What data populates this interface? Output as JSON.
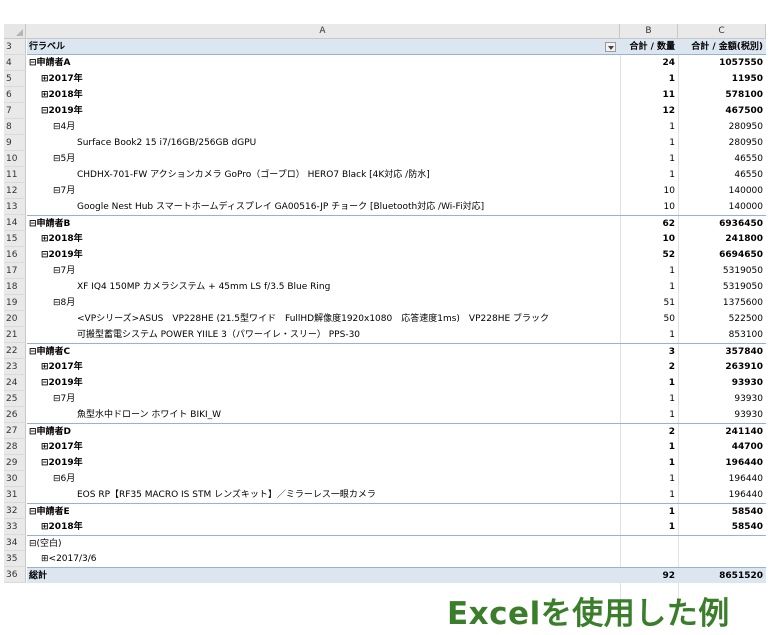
{
  "columns": {
    "a": "A",
    "b": "B",
    "c": "C"
  },
  "header": {
    "num": "3",
    "label": "行ラベル",
    "b": "合計 / 数量",
    "c": "合計 / 金額(税別)"
  },
  "rows": [
    {
      "num": "4",
      "label": "⊟申請者A",
      "b": "24",
      "c": "1057550",
      "lvl": 0,
      "bold": true
    },
    {
      "num": "5",
      "label": "⊞2017年",
      "b": "1",
      "c": "11950",
      "lvl": 1,
      "bold": true
    },
    {
      "num": "6",
      "label": "⊞2018年",
      "b": "11",
      "c": "578100",
      "lvl": 1,
      "bold": true
    },
    {
      "num": "7",
      "label": "⊟2019年",
      "b": "12",
      "c": "467500",
      "lvl": 1,
      "bold": true
    },
    {
      "num": "8",
      "label": "⊟4月",
      "b": "1",
      "c": "280950",
      "lvl": 2,
      "bold": false
    },
    {
      "num": "9",
      "label": "Surface Book2 15 i7/16GB/256GB dGPU",
      "b": "1",
      "c": "280950",
      "lvl": 3,
      "bold": false
    },
    {
      "num": "10",
      "label": "⊟5月",
      "b": "1",
      "c": "46550",
      "lvl": 2,
      "bold": false
    },
    {
      "num": "11",
      "label": "CHDHX-701-FW アクションカメラ GoPro（ゴープロ） HERO7 Black [4K対応 /防水]",
      "b": "1",
      "c": "46550",
      "lvl": 3,
      "bold": false
    },
    {
      "num": "12",
      "label": "⊟7月",
      "b": "10",
      "c": "140000",
      "lvl": 2,
      "bold": false
    },
    {
      "num": "13",
      "label": "Google Nest Hub スマートホームディスプレイ GA00516-JP チョーク [Bluetooth対応 /Wi-Fi対応]",
      "b": "10",
      "c": "140000",
      "lvl": 3,
      "bold": false
    },
    {
      "num": "14",
      "label": "⊟申請者B",
      "b": "62",
      "c": "6936450",
      "lvl": 0,
      "bold": true,
      "topline": true
    },
    {
      "num": "15",
      "label": "⊞2018年",
      "b": "10",
      "c": "241800",
      "lvl": 1,
      "bold": true
    },
    {
      "num": "16",
      "label": "⊟2019年",
      "b": "52",
      "c": "6694650",
      "lvl": 1,
      "bold": true
    },
    {
      "num": "17",
      "label": "⊟7月",
      "b": "1",
      "c": "5319050",
      "lvl": 2,
      "bold": false
    },
    {
      "num": "18",
      "label": "XF IQ4 150MP カメラシステム + 45mm LS f/3.5 Blue Ring",
      "b": "1",
      "c": "5319050",
      "lvl": 3,
      "bold": false
    },
    {
      "num": "19",
      "label": "⊟8月",
      "b": "51",
      "c": "1375600",
      "lvl": 2,
      "bold": false
    },
    {
      "num": "20",
      "label": "<VPシリーズ>ASUS　VP228HE (21.5型ワイド　FullHD解像度1920x1080　応答速度1ms)　VP228HE ブラック",
      "b": "50",
      "c": "522500",
      "lvl": 3,
      "bold": false
    },
    {
      "num": "21",
      "label": "可搬型蓄電システム POWER YIILE 3（パワーイレ・スリー） PPS-30",
      "b": "1",
      "c": "853100",
      "lvl": 3,
      "bold": false
    },
    {
      "num": "22",
      "label": "⊟申請者C",
      "b": "3",
      "c": "357840",
      "lvl": 0,
      "bold": true,
      "topline": true
    },
    {
      "num": "23",
      "label": "⊞2017年",
      "b": "2",
      "c": "263910",
      "lvl": 1,
      "bold": true
    },
    {
      "num": "24",
      "label": "⊟2019年",
      "b": "1",
      "c": "93930",
      "lvl": 1,
      "bold": true
    },
    {
      "num": "25",
      "label": "⊟7月",
      "b": "1",
      "c": "93930",
      "lvl": 2,
      "bold": false
    },
    {
      "num": "26",
      "label": "魚型水中ドローン ホワイト BIKI_W",
      "b": "1",
      "c": "93930",
      "lvl": 3,
      "bold": false
    },
    {
      "num": "27",
      "label": "⊟申請者D",
      "b": "2",
      "c": "241140",
      "lvl": 0,
      "bold": true,
      "topline": true
    },
    {
      "num": "28",
      "label": "⊞2017年",
      "b": "1",
      "c": "44700",
      "lvl": 1,
      "bold": true
    },
    {
      "num": "29",
      "label": "⊟2019年",
      "b": "1",
      "c": "196440",
      "lvl": 1,
      "bold": true
    },
    {
      "num": "30",
      "label": "⊟6月",
      "b": "1",
      "c": "196440",
      "lvl": 2,
      "bold": false
    },
    {
      "num": "31",
      "label": "EOS RP【RF35 MACRO IS STM レンズキット】／ミラーレス一眼カメラ",
      "b": "1",
      "c": "196440",
      "lvl": 3,
      "bold": false
    },
    {
      "num": "32",
      "label": "⊟申請者E",
      "b": "1",
      "c": "58540",
      "lvl": 0,
      "bold": true,
      "topline": true
    },
    {
      "num": "33",
      "label": "⊞2018年",
      "b": "1",
      "c": "58540",
      "lvl": 1,
      "bold": true
    },
    {
      "num": "34",
      "label": "⊟(空白)",
      "b": "",
      "c": "",
      "lvl": 0,
      "bold": false,
      "topline": true
    },
    {
      "num": "35",
      "label": "⊞<2017/3/6",
      "b": "",
      "c": "",
      "lvl": 1,
      "bold": false
    },
    {
      "num": "36",
      "label": "総計",
      "b": "92",
      "c": "8651520",
      "lvl": 0,
      "bold": true,
      "total": true
    }
  ],
  "caption": "Excelを使用した例"
}
